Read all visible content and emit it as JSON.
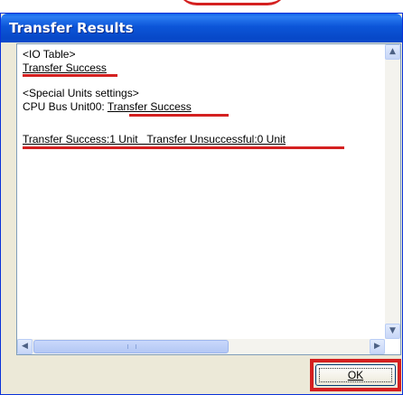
{
  "window": {
    "title": "Transfer Results",
    "title_bar_color": "#0c55d8",
    "background": "#ece9d8"
  },
  "results": {
    "io_table_header": "<IO Table>",
    "io_table_status": "Transfer Success",
    "special_header": "<Special Units settings>",
    "cpu_bus_label": "CPU Bus Unit00:",
    "cpu_bus_status": "Transfer Success",
    "summary": "Transfer Success:1 Unit   Transfer Unsuccessful:0 Unit"
  },
  "scrollbars": {
    "up_arrow": "▲",
    "down_arrow": "▼",
    "left_arrow": "◀",
    "right_arrow": "▶"
  },
  "buttons": {
    "ok_label": "OK"
  },
  "annotation_color": "#d42020"
}
